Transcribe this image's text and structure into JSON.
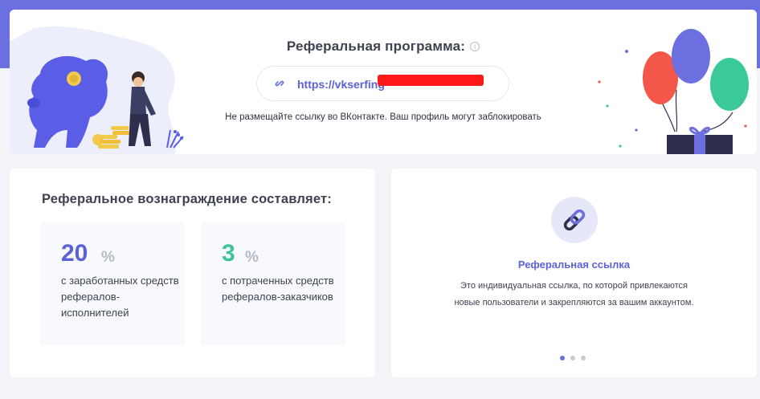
{
  "hero": {
    "title": "Реферальная программа:",
    "info_glyph": "i",
    "link": "https://vkserfing",
    "warning": "Не размещайте ссылку во ВКонтакте. Ваш профиль могут заблокировать"
  },
  "reward": {
    "title": "Реферальное вознаграждение составляет:",
    "rates": [
      {
        "value": "20",
        "unit": "%",
        "description": "с заработанных средств рефералов-исполнителей",
        "color": "#5d61d8"
      },
      {
        "value": "3",
        "unit": "%",
        "description": "с потраченных средств рефералов-заказчиков",
        "color": "#3cc39a"
      }
    ]
  },
  "referral": {
    "title": "Реферальная ссылка",
    "description": "Это индивидуальная ссылка, по которой привлекаются новые пользователи и закрепляются за вашим аккаунтом.",
    "icon": "link-icon",
    "slides_active": 1
  },
  "colors": {
    "accent": "#6b6fe0",
    "link": "#5d61d8",
    "green": "#3cc39a",
    "balloon_red": "#f2574a",
    "balloon_purple": "#6b6fe0",
    "balloon_green": "#3cc99a"
  }
}
